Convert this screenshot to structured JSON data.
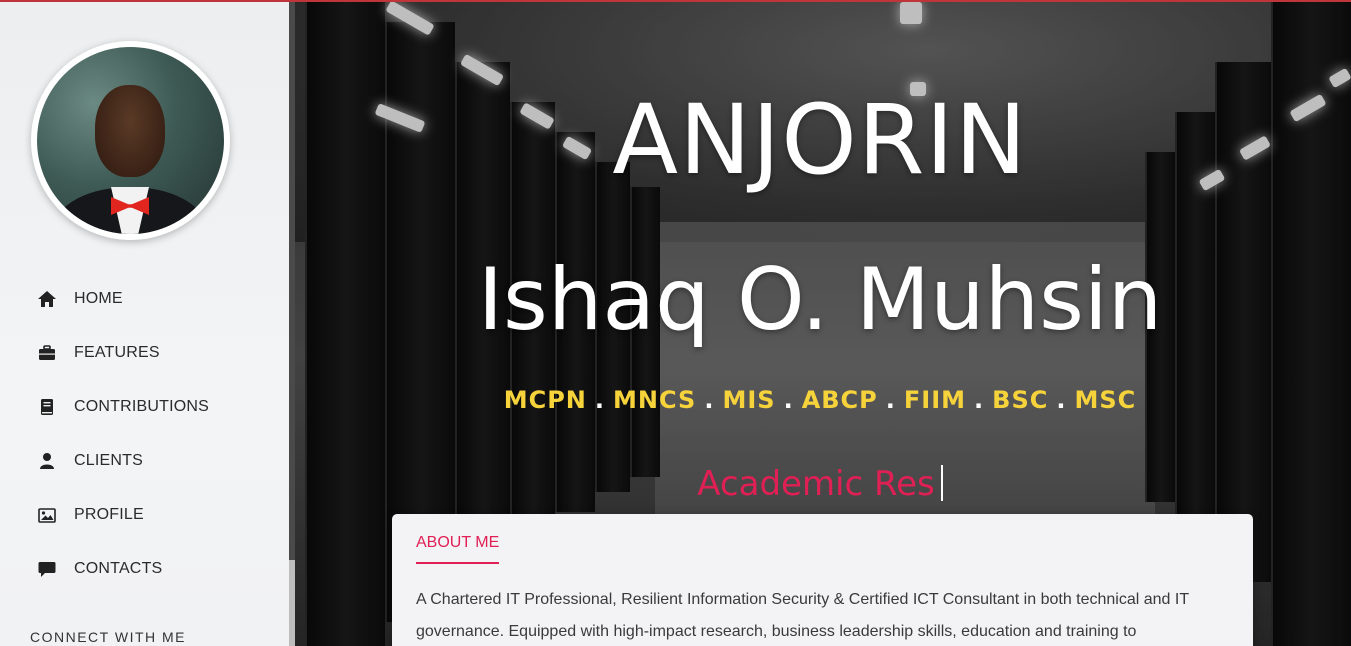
{
  "sidebar": {
    "nav": [
      {
        "label": "HOME",
        "icon": "home-icon"
      },
      {
        "label": "FEATURES",
        "icon": "briefcase-icon"
      },
      {
        "label": "CONTRIBUTIONS",
        "icon": "book-icon"
      },
      {
        "label": "CLIENTS",
        "icon": "user-icon"
      },
      {
        "label": "PROFILE",
        "icon": "image-icon"
      },
      {
        "label": "CONTACTS",
        "icon": "comment-icon"
      }
    ],
    "connect_label": "CONNECT WITH ME"
  },
  "hero": {
    "first_name": "ANJORIN",
    "full_name": "Ishaq O. Muhsin",
    "qualifications": [
      "MCPN",
      "MNCS",
      "MIS",
      "ABCP",
      "FIIM",
      "BSC",
      "MSC"
    ],
    "separator": ".",
    "typing_text": "Academic Res"
  },
  "about": {
    "title": "ABOUT ME",
    "text": "A Chartered IT Professional, Resilient Information Security & Certified ICT Consultant in both technical and IT governance. Equipped with high-impact research, business leadership skills, education and training to"
  },
  "colors": {
    "accent": "#e01f55",
    "qualifications": "#f7d33b",
    "top_bar": "#c0343c"
  }
}
